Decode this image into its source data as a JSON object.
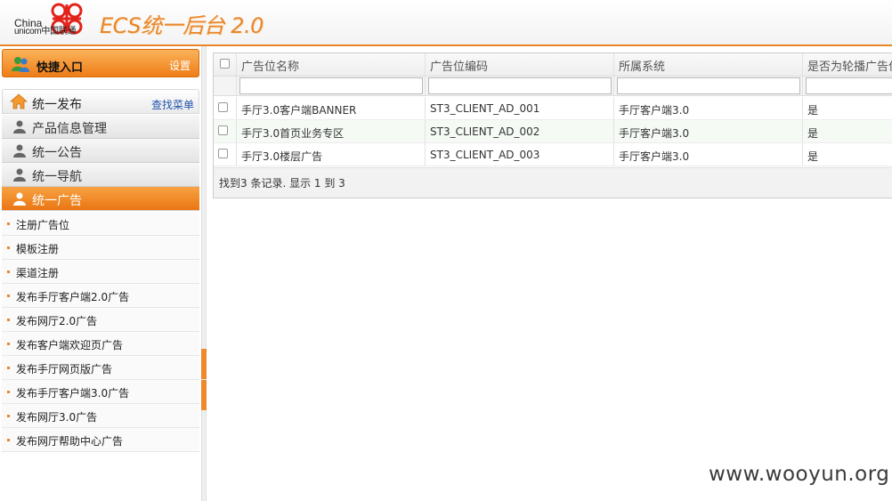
{
  "header": {
    "logo_line1": "China",
    "logo_line2": "unicom中国联通",
    "app_title": "ECS统一后台 2.0",
    "brand_color": "#e8862a"
  },
  "sidebar": {
    "quick": {
      "label": "快捷入口",
      "settings": "设置",
      "icon": "users-icon"
    },
    "group": {
      "label": "统一发布",
      "find_menu": "查找菜单",
      "icon": "home-icon"
    },
    "menu": [
      {
        "label": "产品信息管理",
        "icon": "user-icon",
        "active": false
      },
      {
        "label": "统一公告",
        "icon": "user-icon",
        "active": false
      },
      {
        "label": "统一导航",
        "icon": "user-icon",
        "active": false
      },
      {
        "label": "统一广告",
        "icon": "user-icon",
        "active": true
      }
    ],
    "submenu": [
      {
        "label": "注册广告位"
      },
      {
        "label": "模板注册"
      },
      {
        "label": "渠道注册"
      },
      {
        "label": "发布手厅客户端2.0广告"
      },
      {
        "label": "发布网厅2.0广告"
      },
      {
        "label": "发布客户端欢迎页广告"
      },
      {
        "label": "发布手厅网页版广告"
      },
      {
        "label": "发布手厅客户端3.0广告"
      },
      {
        "label": "发布网厅3.0广告"
      },
      {
        "label": "发布网厅帮助中心广告"
      }
    ]
  },
  "grid": {
    "columns": [
      "广告位名称",
      "广告位编码",
      "所属系统",
      "是否为轮播广告位"
    ],
    "filters": [
      "",
      "",
      "",
      ""
    ],
    "rows": [
      [
        "手厅3.0客户端BANNER",
        "ST3_CLIENT_AD_001",
        "手厅客户端3.0",
        "是"
      ],
      [
        "手厅3.0首页业务专区",
        "ST3_CLIENT_AD_002",
        "手厅客户端3.0",
        "是"
      ],
      [
        "手厅3.0楼层广告",
        "ST3_CLIENT_AD_003",
        "手厅客户端3.0",
        "是"
      ]
    ],
    "footer": "找到3 条记录. 显示 1 到 3"
  },
  "watermark": "www.wooyun.org"
}
